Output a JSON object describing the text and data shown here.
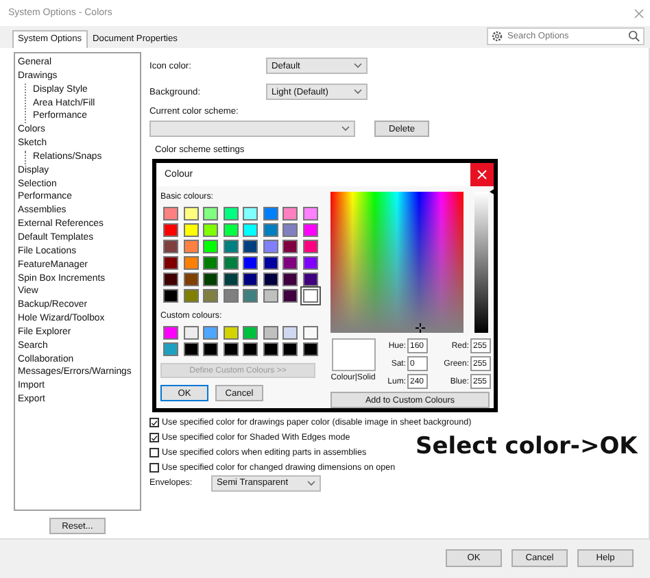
{
  "window": {
    "title": "System Options - Colors"
  },
  "tabs": [
    {
      "label": "System Options",
      "selected": true
    },
    {
      "label": "Document Properties",
      "selected": false
    }
  ],
  "search": {
    "placeholder": "Search Options"
  },
  "tree": [
    {
      "label": "General"
    },
    {
      "label": "Drawings",
      "children": [
        {
          "label": "Display Style"
        },
        {
          "label": "Area Hatch/Fill"
        },
        {
          "label": "Performance"
        }
      ]
    },
    {
      "label": "Colors"
    },
    {
      "label": "Sketch",
      "children": [
        {
          "label": "Relations/Snaps"
        }
      ]
    },
    {
      "label": "Display"
    },
    {
      "label": "Selection"
    },
    {
      "label": "Performance"
    },
    {
      "label": "Assemblies"
    },
    {
      "label": "External References"
    },
    {
      "label": "Default Templates"
    },
    {
      "label": "File Locations"
    },
    {
      "label": "FeatureManager"
    },
    {
      "label": "Spin Box Increments"
    },
    {
      "label": "View"
    },
    {
      "label": "Backup/Recover"
    },
    {
      "label": "Hole Wizard/Toolbox"
    },
    {
      "label": "File Explorer"
    },
    {
      "label": "Search"
    },
    {
      "label": "Collaboration"
    },
    {
      "label": "Messages/Errors/Warnings"
    },
    {
      "label": "Import"
    },
    {
      "label": "Export"
    }
  ],
  "reset_button": "Reset...",
  "settings": {
    "icon_color": {
      "label": "Icon color:",
      "value": "Default"
    },
    "background": {
      "label": "Background:",
      "value": "Light (Default)"
    },
    "scheme": {
      "label": "Current color scheme:"
    },
    "delete_button": "Delete",
    "group_label": "Color scheme settings"
  },
  "colour_dialog": {
    "title": "Colour",
    "basic_label": "Basic colours:",
    "basic": [
      {
        "color": "#ff8080",
        "selected": false
      },
      {
        "color": "#ffff80",
        "selected": false
      },
      {
        "color": "#80ff80",
        "selected": false
      },
      {
        "color": "#00ff80",
        "selected": false
      },
      {
        "color": "#80ffff",
        "selected": false
      },
      {
        "color": "#0080ff",
        "selected": false
      },
      {
        "color": "#ff80c0",
        "selected": false
      },
      {
        "color": "#ff80ff",
        "selected": false
      },
      {
        "color": "#ff0000",
        "selected": false
      },
      {
        "color": "#ffff00",
        "selected": false
      },
      {
        "color": "#80ff00",
        "selected": false
      },
      {
        "color": "#00ff40",
        "selected": false
      },
      {
        "color": "#00ffff",
        "selected": false
      },
      {
        "color": "#0080c0",
        "selected": false
      },
      {
        "color": "#8080c0",
        "selected": false
      },
      {
        "color": "#ff00ff",
        "selected": false
      },
      {
        "color": "#804040",
        "selected": false
      },
      {
        "color": "#ff8040",
        "selected": false
      },
      {
        "color": "#00ff00",
        "selected": false
      },
      {
        "color": "#008080",
        "selected": false
      },
      {
        "color": "#004080",
        "selected": false
      },
      {
        "color": "#8080ff",
        "selected": false
      },
      {
        "color": "#800040",
        "selected": false
      },
      {
        "color": "#ff0080",
        "selected": false
      },
      {
        "color": "#800000",
        "selected": false
      },
      {
        "color": "#ff8000",
        "selected": false
      },
      {
        "color": "#008000",
        "selected": false
      },
      {
        "color": "#008040",
        "selected": false
      },
      {
        "color": "#0000ff",
        "selected": false
      },
      {
        "color": "#0000a0",
        "selected": false
      },
      {
        "color": "#800080",
        "selected": false
      },
      {
        "color": "#8000ff",
        "selected": false
      },
      {
        "color": "#400000",
        "selected": false
      },
      {
        "color": "#804000",
        "selected": false
      },
      {
        "color": "#004000",
        "selected": false
      },
      {
        "color": "#004040",
        "selected": false
      },
      {
        "color": "#000080",
        "selected": false
      },
      {
        "color": "#000040",
        "selected": false
      },
      {
        "color": "#400040",
        "selected": false
      },
      {
        "color": "#400080",
        "selected": false
      },
      {
        "color": "#000000",
        "selected": false
      },
      {
        "color": "#808000",
        "selected": false
      },
      {
        "color": "#808040",
        "selected": false
      },
      {
        "color": "#808080",
        "selected": false
      },
      {
        "color": "#408080",
        "selected": false
      },
      {
        "color": "#c0c0c0",
        "selected": false
      },
      {
        "color": "#400040",
        "selected": false
      },
      {
        "color": "#ffffff",
        "selected": true
      }
    ],
    "custom_label": "Custom colours:",
    "custom": [
      {
        "color": "#ff00ff",
        "selected": false
      },
      {
        "color": "#ececec",
        "selected": false
      },
      {
        "color": "#4da6ff",
        "selected": false
      },
      {
        "color": "#d4d400",
        "selected": false
      },
      {
        "color": "#00c040",
        "selected": false
      },
      {
        "color": "#c0c0c0",
        "selected": false
      },
      {
        "color": "#d0d8f0",
        "selected": false
      },
      {
        "color": "#f8f8f8",
        "selected": false
      },
      {
        "color": "#20a0c0",
        "selected": false
      },
      {
        "color": "#000000",
        "selected": false
      },
      {
        "color": "#000000",
        "selected": false
      },
      {
        "color": "#000000",
        "selected": false
      },
      {
        "color": "#000000",
        "selected": false
      },
      {
        "color": "#000000",
        "selected": false
      },
      {
        "color": "#000000",
        "selected": false
      },
      {
        "color": "#000000",
        "selected": false
      }
    ],
    "define_button": {
      "label": "Define Custom Colours >>",
      "disabled": true
    },
    "ok_button": "OK",
    "cancel_button": "Cancel",
    "lum_slider": {
      "level": 1
    },
    "preview": {
      "color": "#ffffff",
      "label": "Colour|Solid"
    },
    "hsl": [
      {
        "label": "Hue:",
        "value": "160"
      },
      {
        "label": "Sat:",
        "value": "0"
      },
      {
        "label": "Lum:",
        "value": "240"
      }
    ],
    "rgb": [
      {
        "label": "Red:",
        "value": "255"
      },
      {
        "label": "Green:",
        "value": "255"
      },
      {
        "label": "Blue:",
        "value": "255"
      }
    ],
    "add_button": "Add to Custom Colours"
  },
  "checkboxes": [
    {
      "label": "Use specified color for drawings paper color (disable image in sheet background)",
      "checked": true
    },
    {
      "label": "Use specified color for Shaded With Edges mode",
      "checked": true
    },
    {
      "label": "Use specified colors when editing parts in assemblies",
      "checked": false
    },
    {
      "label": "Use specified color for changed drawing dimensions on open",
      "checked": false
    }
  ],
  "envelopes": {
    "label": "Envelopes:",
    "value": "Semi Transparent"
  },
  "annotation": "Select color->OK",
  "buttons": [
    "OK",
    "Cancel",
    "Help"
  ]
}
